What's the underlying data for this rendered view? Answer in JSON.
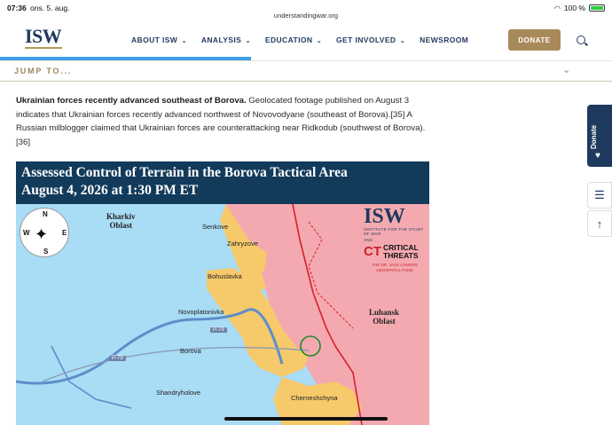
{
  "status": {
    "time": "07:36",
    "date": "ons. 5. aug.",
    "url": "understandingwar.org",
    "battery": "100 %"
  },
  "header": {
    "logo_text": "ISW",
    "nav": [
      {
        "label": "ABOUT ISW",
        "dropdown": true
      },
      {
        "label": "ANALYSIS",
        "dropdown": true
      },
      {
        "label": "EDUCATION",
        "dropdown": true
      },
      {
        "label": "GET INVOLVED",
        "dropdown": true
      },
      {
        "label": "NEWSROOM",
        "dropdown": false
      }
    ],
    "donate_label": "DONATE",
    "search_icon": "search-icon"
  },
  "jump": {
    "label": "JUMP TO...",
    "progress_fraction": 0.41
  },
  "article": {
    "lead": "Ukrainian forces recently advanced southeast of Borova.",
    "body": " Geolocated footage published on August 3 indicates that Ukrainian forces recently advanced northwest of Novovodyane (southeast of Borova).[35] A Russian milblogger claimed that Ukrainian forces are counterattacking near Ridkodub (southwest of Borova).[36]"
  },
  "side": {
    "donate_label": "Donate",
    "toc_icon": "list-icon",
    "up_icon": "arrow-up-icon"
  },
  "map": {
    "title_line1": "Assessed Control of Terrain in the Borova Tactical Area",
    "title_line2": "August 4, 2026 at 1:30 PM ET",
    "compass": {
      "n": "N",
      "s": "S",
      "e": "E",
      "w": "W"
    },
    "regions": {
      "kharkiv": "Kharkiv\nOblast",
      "luhansk": "Luhansk\nOblast"
    },
    "places": {
      "senkove": "Senkove",
      "zahryzove": "Zahryzove",
      "bohuslavka": "Bohuslavka",
      "novoplatonivka": "Novoplatonivka",
      "borova": "Borova",
      "shandryholove": "Shandryholove",
      "cherneshchyna": "Cherneshchyna"
    },
    "roads": {
      "r1": "P-79",
      "r2": "P-79"
    },
    "branding": {
      "logo": "ISW",
      "logo_sub": "INSTITUTE FOR THE STUDY OF WAR",
      "and": "AND",
      "ct_mark": "CT",
      "ct_text1": "CRITICAL",
      "ct_text2": "THREATS",
      "fund1": "THE DR. JACK LONDON",
      "fund2": "GEOSPATIAL FUND"
    },
    "colors": {
      "ukraine": "#a9dcf5",
      "russia": "#f4a9b0",
      "contested": "#f6c96b",
      "river": "#5d8ec9",
      "frontline": "#d4202c"
    }
  }
}
